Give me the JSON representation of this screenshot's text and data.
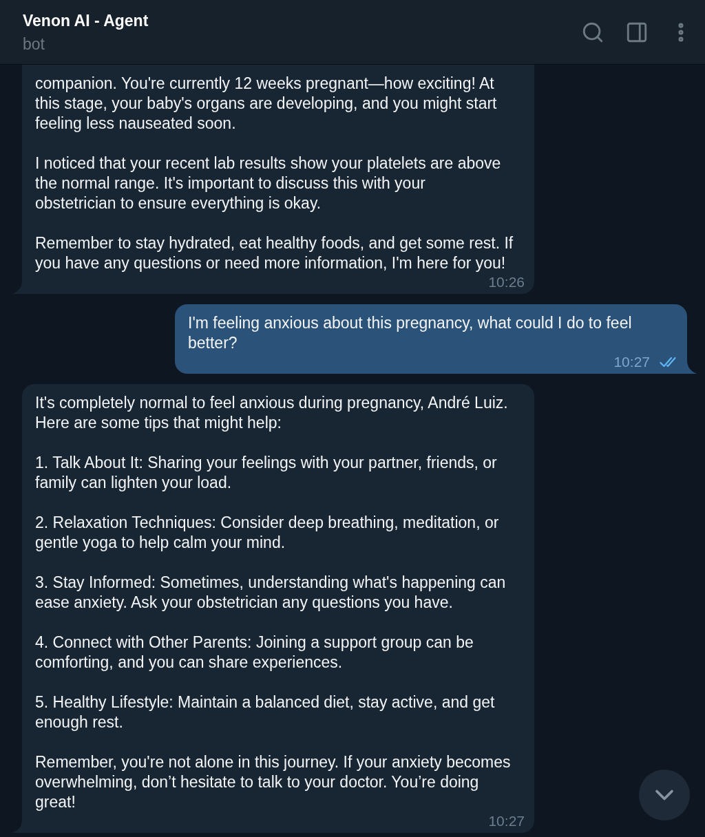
{
  "header": {
    "title": "Venon AI - Agent",
    "subtitle": "bot"
  },
  "messages": [
    {
      "kind": "incoming",
      "paragraphs": [
        "companion. You're currently 12 weeks pregnant—how exciting! At\nthis stage, your baby's organs are developing, and you might start\nfeeling less nauseated soon.",
        "I noticed that your recent lab results show your platelets are above\nthe normal range. It's important to discuss this with your\nobstetrician to ensure everything is okay.",
        "Remember to stay hydrated, eat healthy foods, and get some rest. If\nyou have any questions or need more information, I'm here for you!"
      ],
      "time": "10:26"
    },
    {
      "kind": "outgoing",
      "paragraphs": [
        "I'm feeling anxious about this pregnancy, what could I do to feel\nbetter?"
      ],
      "time": "10:27",
      "read": true
    },
    {
      "kind": "incoming",
      "paragraphs": [
        "It's completely normal to feel anxious during pregnancy, André Luiz.\nHere are some tips that might help:",
        "1. Talk About It: Sharing your feelings with your partner, friends, or\nfamily can lighten your load.",
        "2. Relaxation Techniques: Consider deep breathing, meditation, or\ngentle yoga to help calm your mind.",
        "3. Stay Informed: Sometimes, understanding what's happening can\nease anxiety. Ask your obstetrician any questions you have.",
        "4. Connect with Other Parents: Joining a support group can be\ncomforting, and you can share experiences.",
        "5. Healthy Lifestyle: Maintain a balanced diet, stay active, and get\nenough rest.",
        "Remember, you're not alone in this journey. If your anxiety becomes\noverwhelming, don’t hesitate to talk to your doctor. You’re doing\ngreat!"
      ],
      "time": "10:27"
    }
  ]
}
